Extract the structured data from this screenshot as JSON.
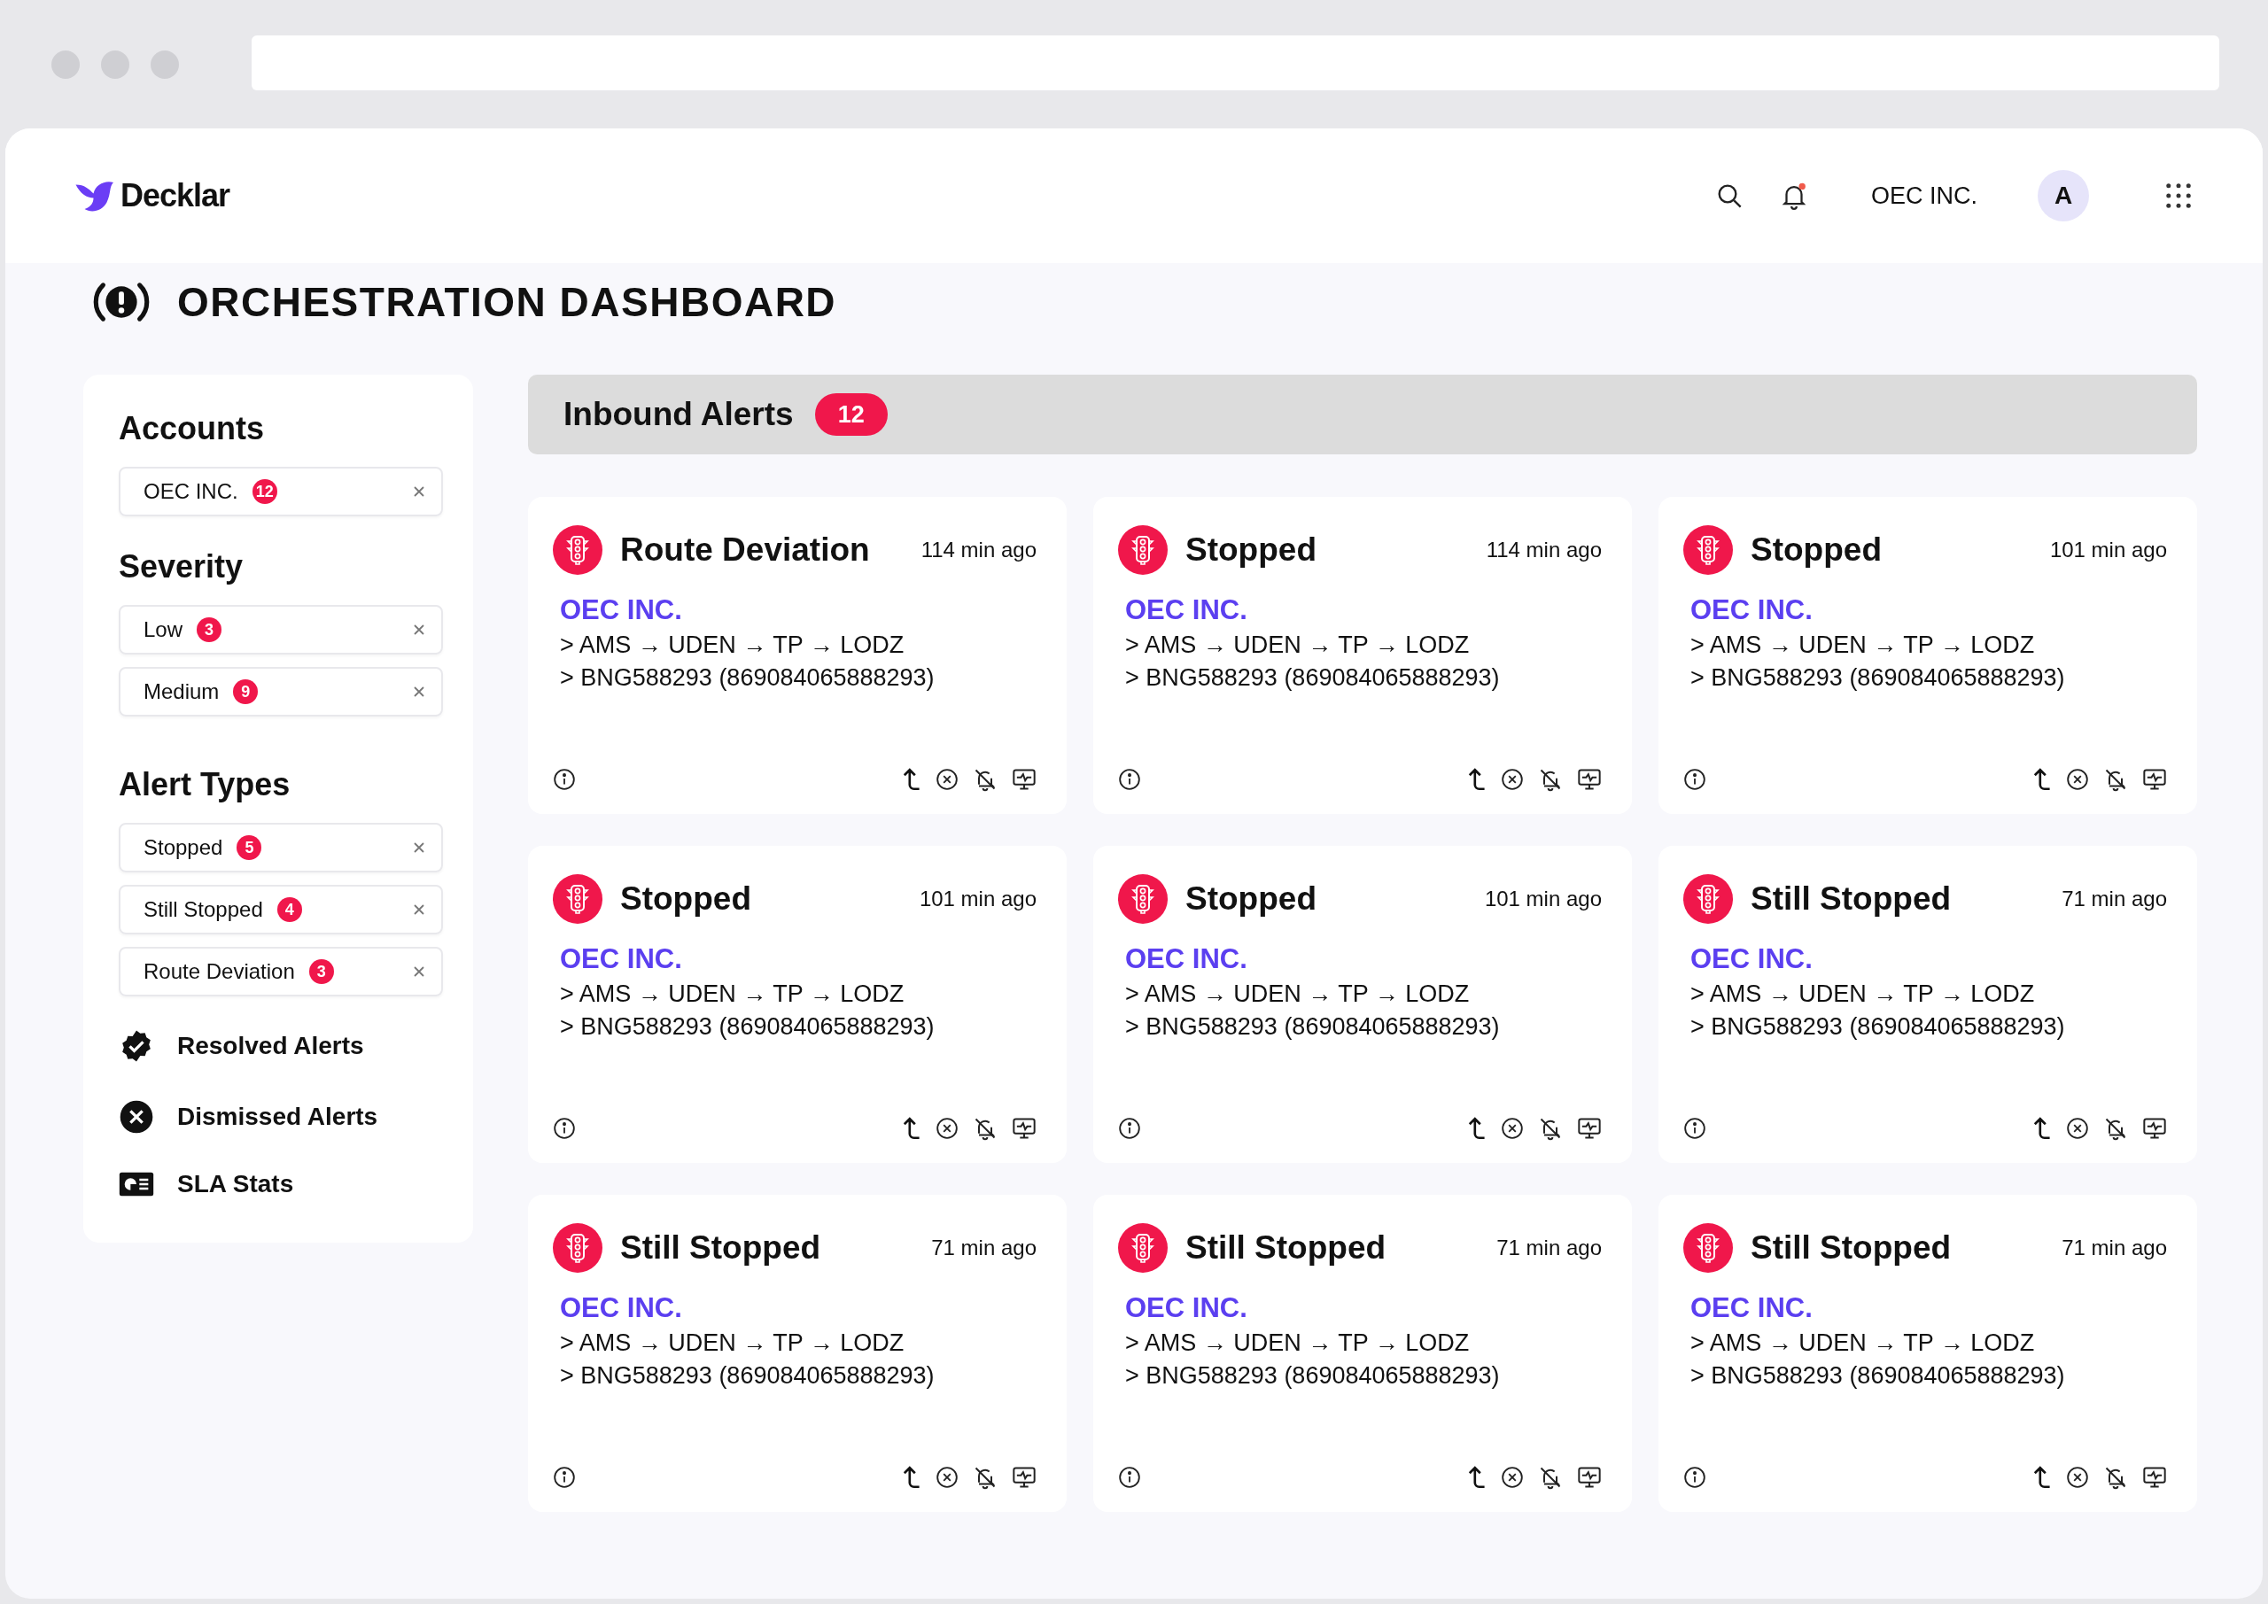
{
  "header": {
    "logo": "Decklar",
    "account": "OEC INC.",
    "avatar": "A",
    "notification_dot": true
  },
  "page_title": "ORCHESTRATION DASHBOARD",
  "sidebar": {
    "sections": [
      {
        "title": "Accounts",
        "filters": [
          {
            "label": "OEC INC.",
            "count": "12"
          }
        ]
      },
      {
        "title": "Severity",
        "filters": [
          {
            "label": "Low",
            "count": "3"
          },
          {
            "label": "Medium",
            "count": "9"
          }
        ]
      },
      {
        "title": "Alert Types",
        "filters": [
          {
            "label": "Stopped",
            "count": "5"
          },
          {
            "label": "Still Stopped",
            "count": "4"
          },
          {
            "label": "Route Deviation",
            "count": "3"
          }
        ]
      }
    ],
    "links": [
      {
        "label": "Resolved Alerts",
        "kind": "resolved"
      },
      {
        "label": "Dismissed Alerts",
        "kind": "dismissed"
      },
      {
        "label": "SLA Stats",
        "kind": "stats"
      }
    ]
  },
  "alerts": {
    "title": "Inbound Alerts",
    "count": "12",
    "cards": [
      {
        "type": "Route Deviation",
        "time": "114 min ago",
        "account": "OEC INC.",
        "route": "> AMS → UDEN → TP → LODZ",
        "device": "> BNG588293 (869084065888293)"
      },
      {
        "type": "Stopped",
        "time": "114 min ago",
        "account": "OEC INC.",
        "route": "> AMS → UDEN → TP → LODZ",
        "device": "> BNG588293 (869084065888293)"
      },
      {
        "type": "Stopped",
        "time": "101 min ago",
        "account": "OEC INC.",
        "route": "> AMS → UDEN → TP → LODZ",
        "device": "> BNG588293 (869084065888293)"
      },
      {
        "type": "Stopped",
        "time": "101 min ago",
        "account": "OEC INC.",
        "route": "> AMS → UDEN → TP → LODZ",
        "device": "> BNG588293 (869084065888293)"
      },
      {
        "type": "Stopped",
        "time": "101 min ago",
        "account": "OEC INC.",
        "route": "> AMS → UDEN → TP → LODZ",
        "device": "> BNG588293 (869084065888293)"
      },
      {
        "type": "Still Stopped",
        "time": "71 min ago",
        "account": "OEC INC.",
        "route": "> AMS → UDEN → TP → LODZ",
        "device": "> BNG588293 (869084065888293)"
      },
      {
        "type": "Still Stopped",
        "time": "71 min ago",
        "account": "OEC INC.",
        "route": "> AMS → UDEN → TP → LODZ",
        "device": "> BNG588293 (869084065888293)"
      },
      {
        "type": "Still Stopped",
        "time": "71 min ago",
        "account": "OEC INC.",
        "route": "> AMS → UDEN → TP → LODZ",
        "device": "> BNG588293 (869084065888293)"
      },
      {
        "type": "Still Stopped",
        "time": "71 min ago",
        "account": "OEC INC.",
        "route": "> AMS → UDEN → TP → LODZ",
        "device": "> BNG588293 (869084065888293)"
      }
    ]
  }
}
